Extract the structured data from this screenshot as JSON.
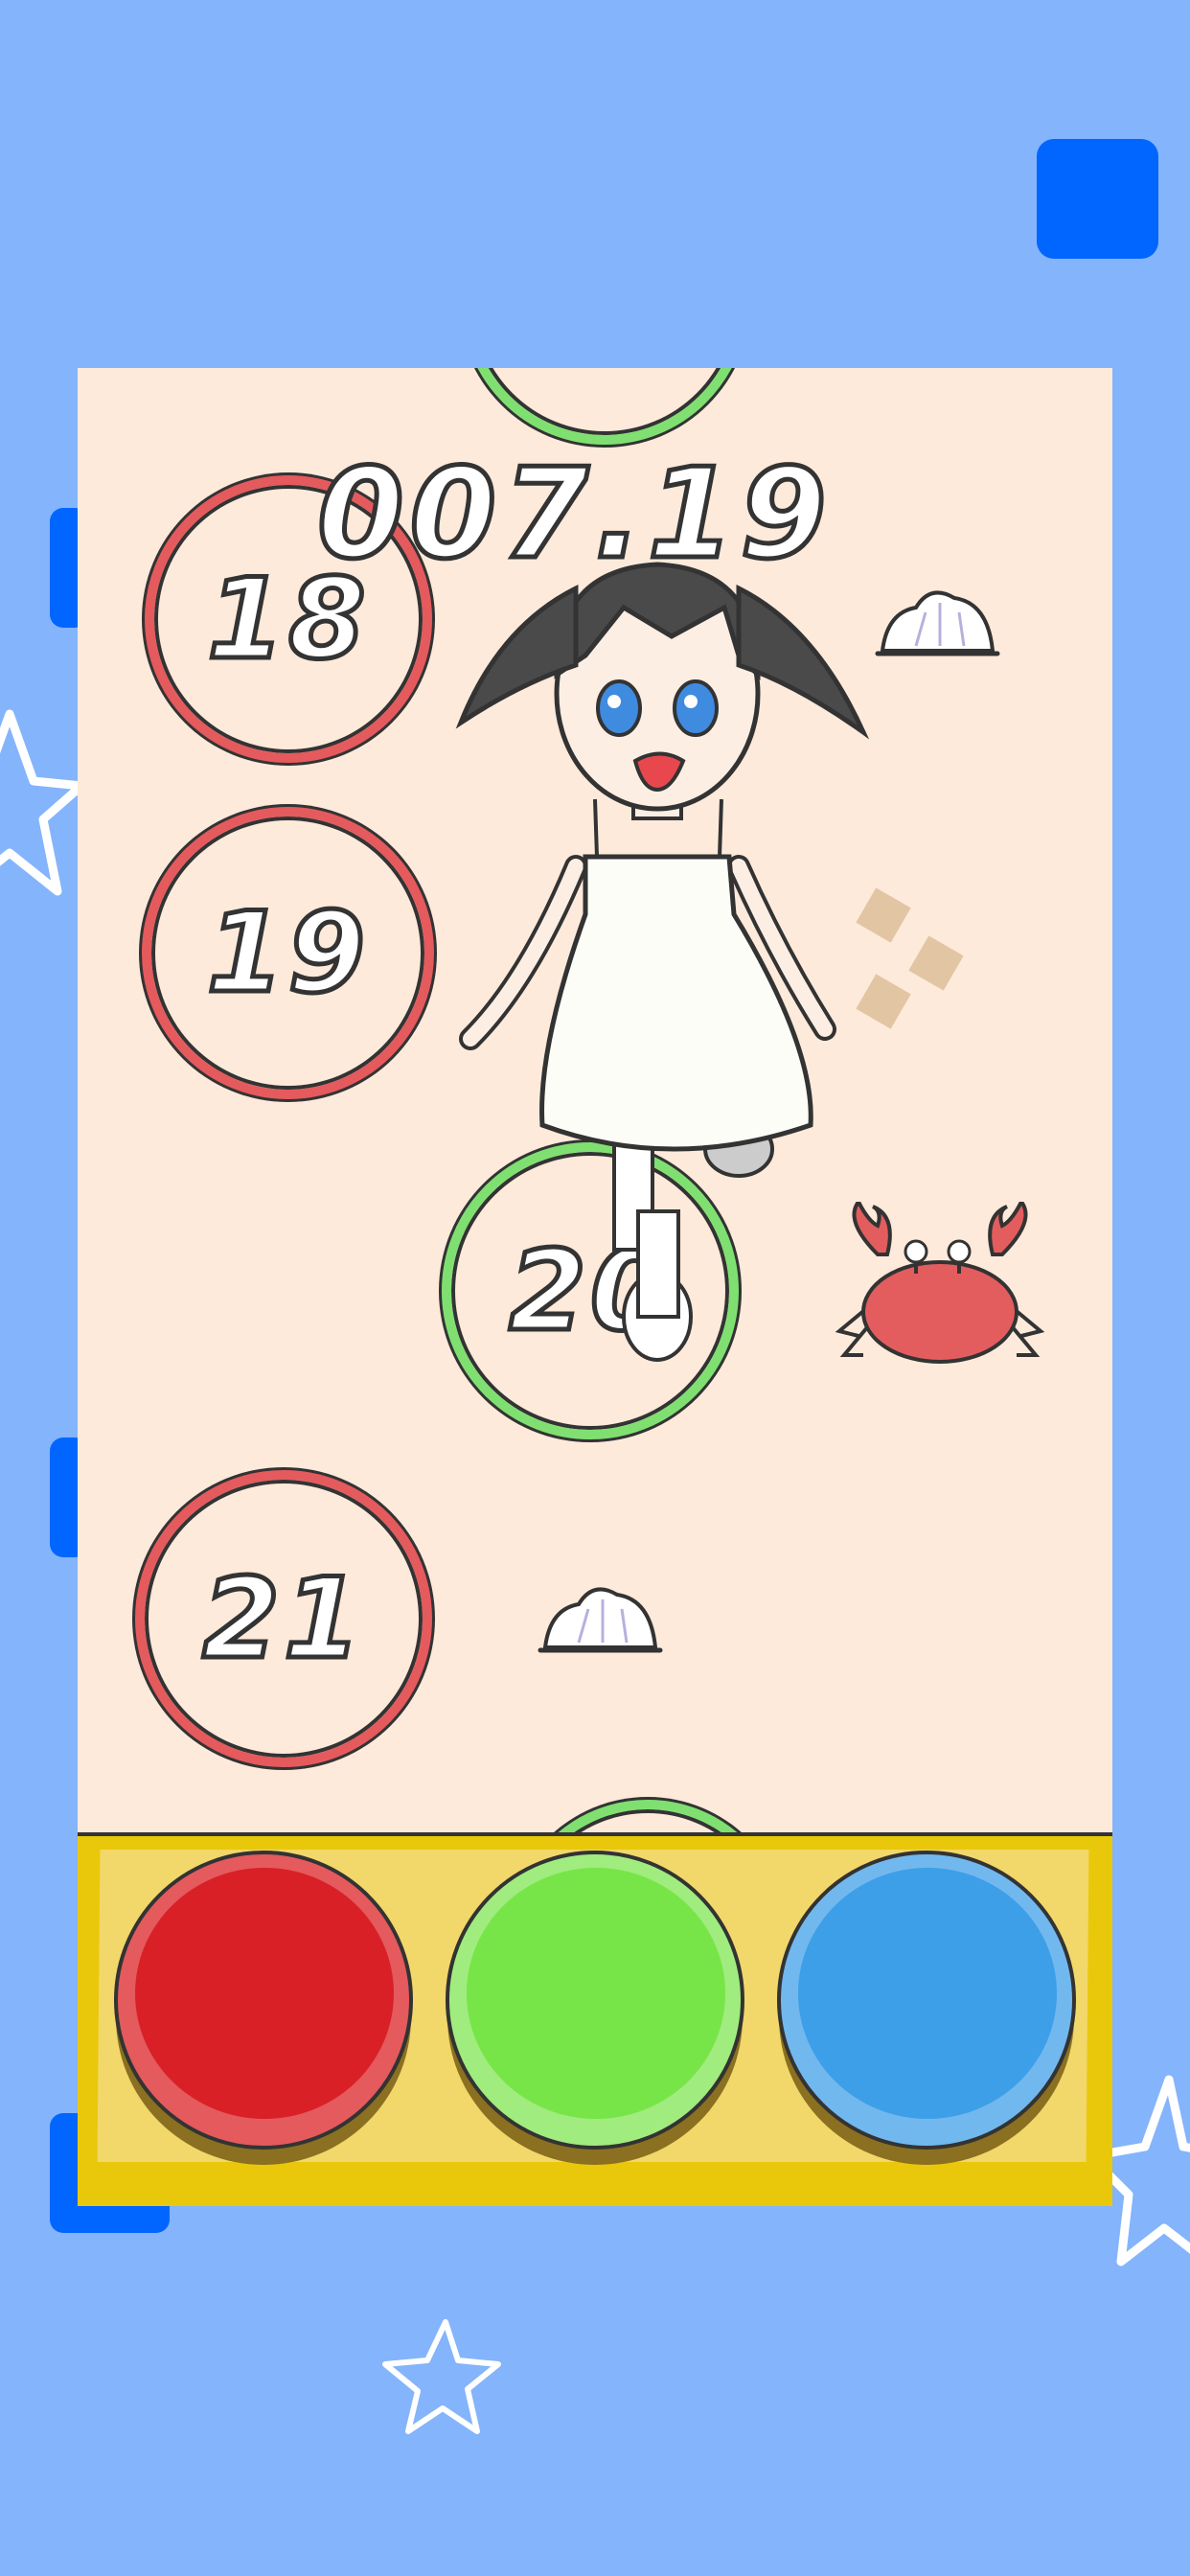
{
  "game": {
    "timer": "007.19",
    "tiles": [
      {
        "number": "18",
        "color": "red"
      },
      {
        "number": "19",
        "color": "red"
      },
      {
        "number": "20",
        "color": "green"
      },
      {
        "number": "21",
        "color": "red"
      }
    ]
  },
  "controls": {
    "buttons": [
      {
        "color_name": "red",
        "color": "#d92027"
      },
      {
        "color_name": "green",
        "color": "#77e548"
      },
      {
        "color_name": "blue",
        "color": "#3d9fe7"
      }
    ]
  },
  "theme": {
    "background": "#84b4fb",
    "accent": "#0066ff",
    "board": "#fdeadb",
    "ring_red": "#e45a5d",
    "ring_green": "#7fe071",
    "tray": "#e9c80c"
  },
  "icons": [
    "pause-icon",
    "star-icon",
    "crab-icon",
    "seashell-icon",
    "character-sprite"
  ]
}
